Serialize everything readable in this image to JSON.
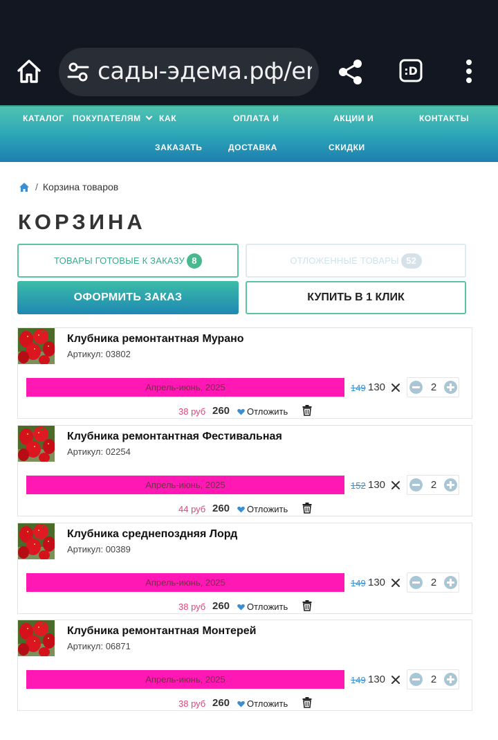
{
  "browser": {
    "url": "сады-эдема.рф/er",
    "icons": [
      "home-icon",
      "tune-icon",
      "share-icon",
      "extension-icon",
      "more-vert-icon"
    ]
  },
  "nav": {
    "items": [
      {
        "label": "КАТАЛОГ"
      },
      {
        "label": "ПОКУПАТЕЛЯМ"
      },
      {
        "label": "КАК"
      },
      {
        "label": "ОПЛАТА И"
      },
      {
        "label": "АКЦИИ И"
      },
      {
        "label": "КОНТАКТЫ"
      },
      {
        "label": "ЗАКАЗАТЬ"
      },
      {
        "label": "ДОСТАВКА"
      },
      {
        "label": "СКИДКИ"
      }
    ]
  },
  "breadcrumb": {
    "separator": "/",
    "current": "Корзина товаров"
  },
  "page": {
    "title": "КОРЗИНА"
  },
  "tabs": {
    "ready_label": "ТОВАРЫ ГОТОВЫЕ К ЗАКАЗУ",
    "ready_count": "8",
    "deferred_label": "ОТЛОЖЕННЫЕ ТОВАРЫ",
    "deferred_count": "52"
  },
  "actions": {
    "order_label": "ОФОРМИТЬ ЗАКАЗ",
    "one_click_label": "КУПИТЬ В 1 КЛИК"
  },
  "colors": {
    "accent": "#47b98e",
    "shipping_bar": "#ff18b4",
    "saving_text": "#e0457b",
    "old_price": "#3b8fd0"
  },
  "items": [
    {
      "name": "Клубника ремонтантная Мурано",
      "sku": "Артикул: 03802",
      "shipping": "Апрель-июнь, 2025",
      "old_price": "149",
      "price": "130",
      "qty": "2",
      "saving": "38 руб",
      "total": "260",
      "defer_label": "Отложить"
    },
    {
      "name": "Клубника ремонтантная Фестивальная",
      "sku": "Артикул: 02254",
      "shipping": "Апрель-июнь, 2025",
      "old_price": "152",
      "price": "130",
      "qty": "2",
      "saving": "44 руб",
      "total": "260",
      "defer_label": "Отложить"
    },
    {
      "name": "Клубника среднепоздняя Лорд",
      "sku": "Артикул: 00389",
      "shipping": "Апрель-июнь, 2025",
      "old_price": "149",
      "price": "130",
      "qty": "2",
      "saving": "38 руб",
      "total": "260",
      "defer_label": "Отложить"
    },
    {
      "name": "Клубника ремонтантная Монтерей",
      "sku": "Артикул: 06871",
      "shipping": "Апрель-июнь, 2025",
      "old_price": "149",
      "price": "130",
      "qty": "2",
      "saving": "38 руб",
      "total": "260",
      "defer_label": "Отложить"
    }
  ]
}
